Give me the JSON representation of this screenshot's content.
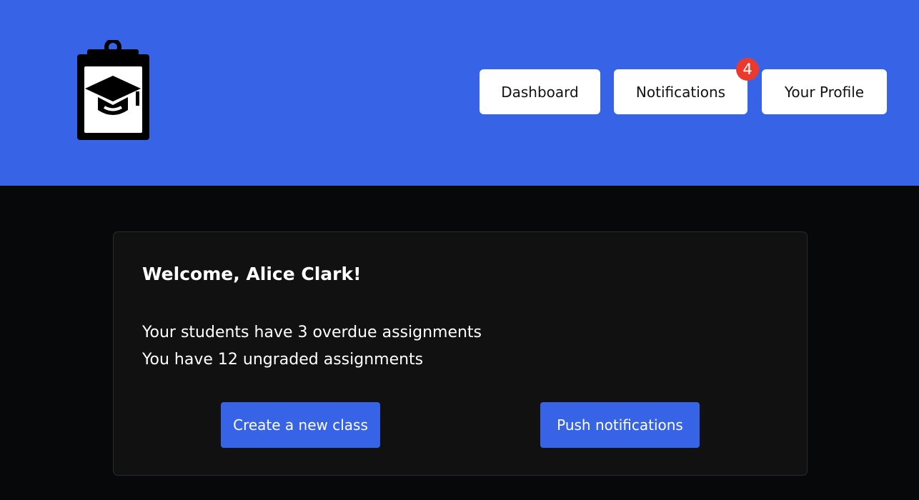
{
  "header": {
    "logo_icon": "clipboard-graduation-cap-icon",
    "background_color": "#3763e6",
    "nav": {
      "dashboard_label": "Dashboard",
      "notifications_label": "Notifications",
      "notifications_badge": "4",
      "profile_label": "Your Profile"
    },
    "badge_color": "#ea3a2e"
  },
  "card": {
    "welcome": "Welcome, Alice Clark!",
    "overdue_text": "Your students have 3 overdue assignments",
    "ungraded_text": "You have 12 ungraded assignments",
    "create_class_label": "Create a new class",
    "push_notifications_label": "Push notifications",
    "accent_color": "#3763e6"
  }
}
